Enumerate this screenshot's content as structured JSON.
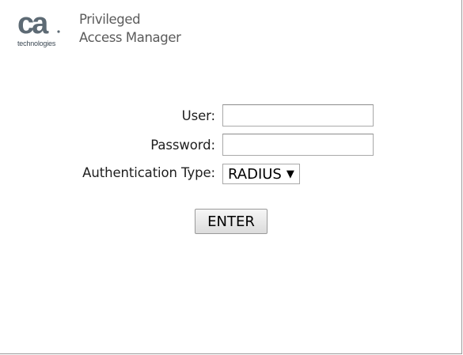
{
  "branding": {
    "logo_text": "ca",
    "logo_subtitle": "technologies",
    "product_line1": "Privileged",
    "product_line2": "Access Manager"
  },
  "login": {
    "user_label": "User:",
    "user_value": "",
    "password_label": "Password:",
    "password_value": "",
    "auth_type_label": "Authentication Type:",
    "auth_type_selected": "RADIUS",
    "enter_label": "ENTER"
  },
  "icons": {
    "dropdown": "caret-down-icon"
  },
  "colors": {
    "logo": "#5d6a74",
    "product_text": "#5b5b5b",
    "label_text": "#1e1e1e"
  }
}
